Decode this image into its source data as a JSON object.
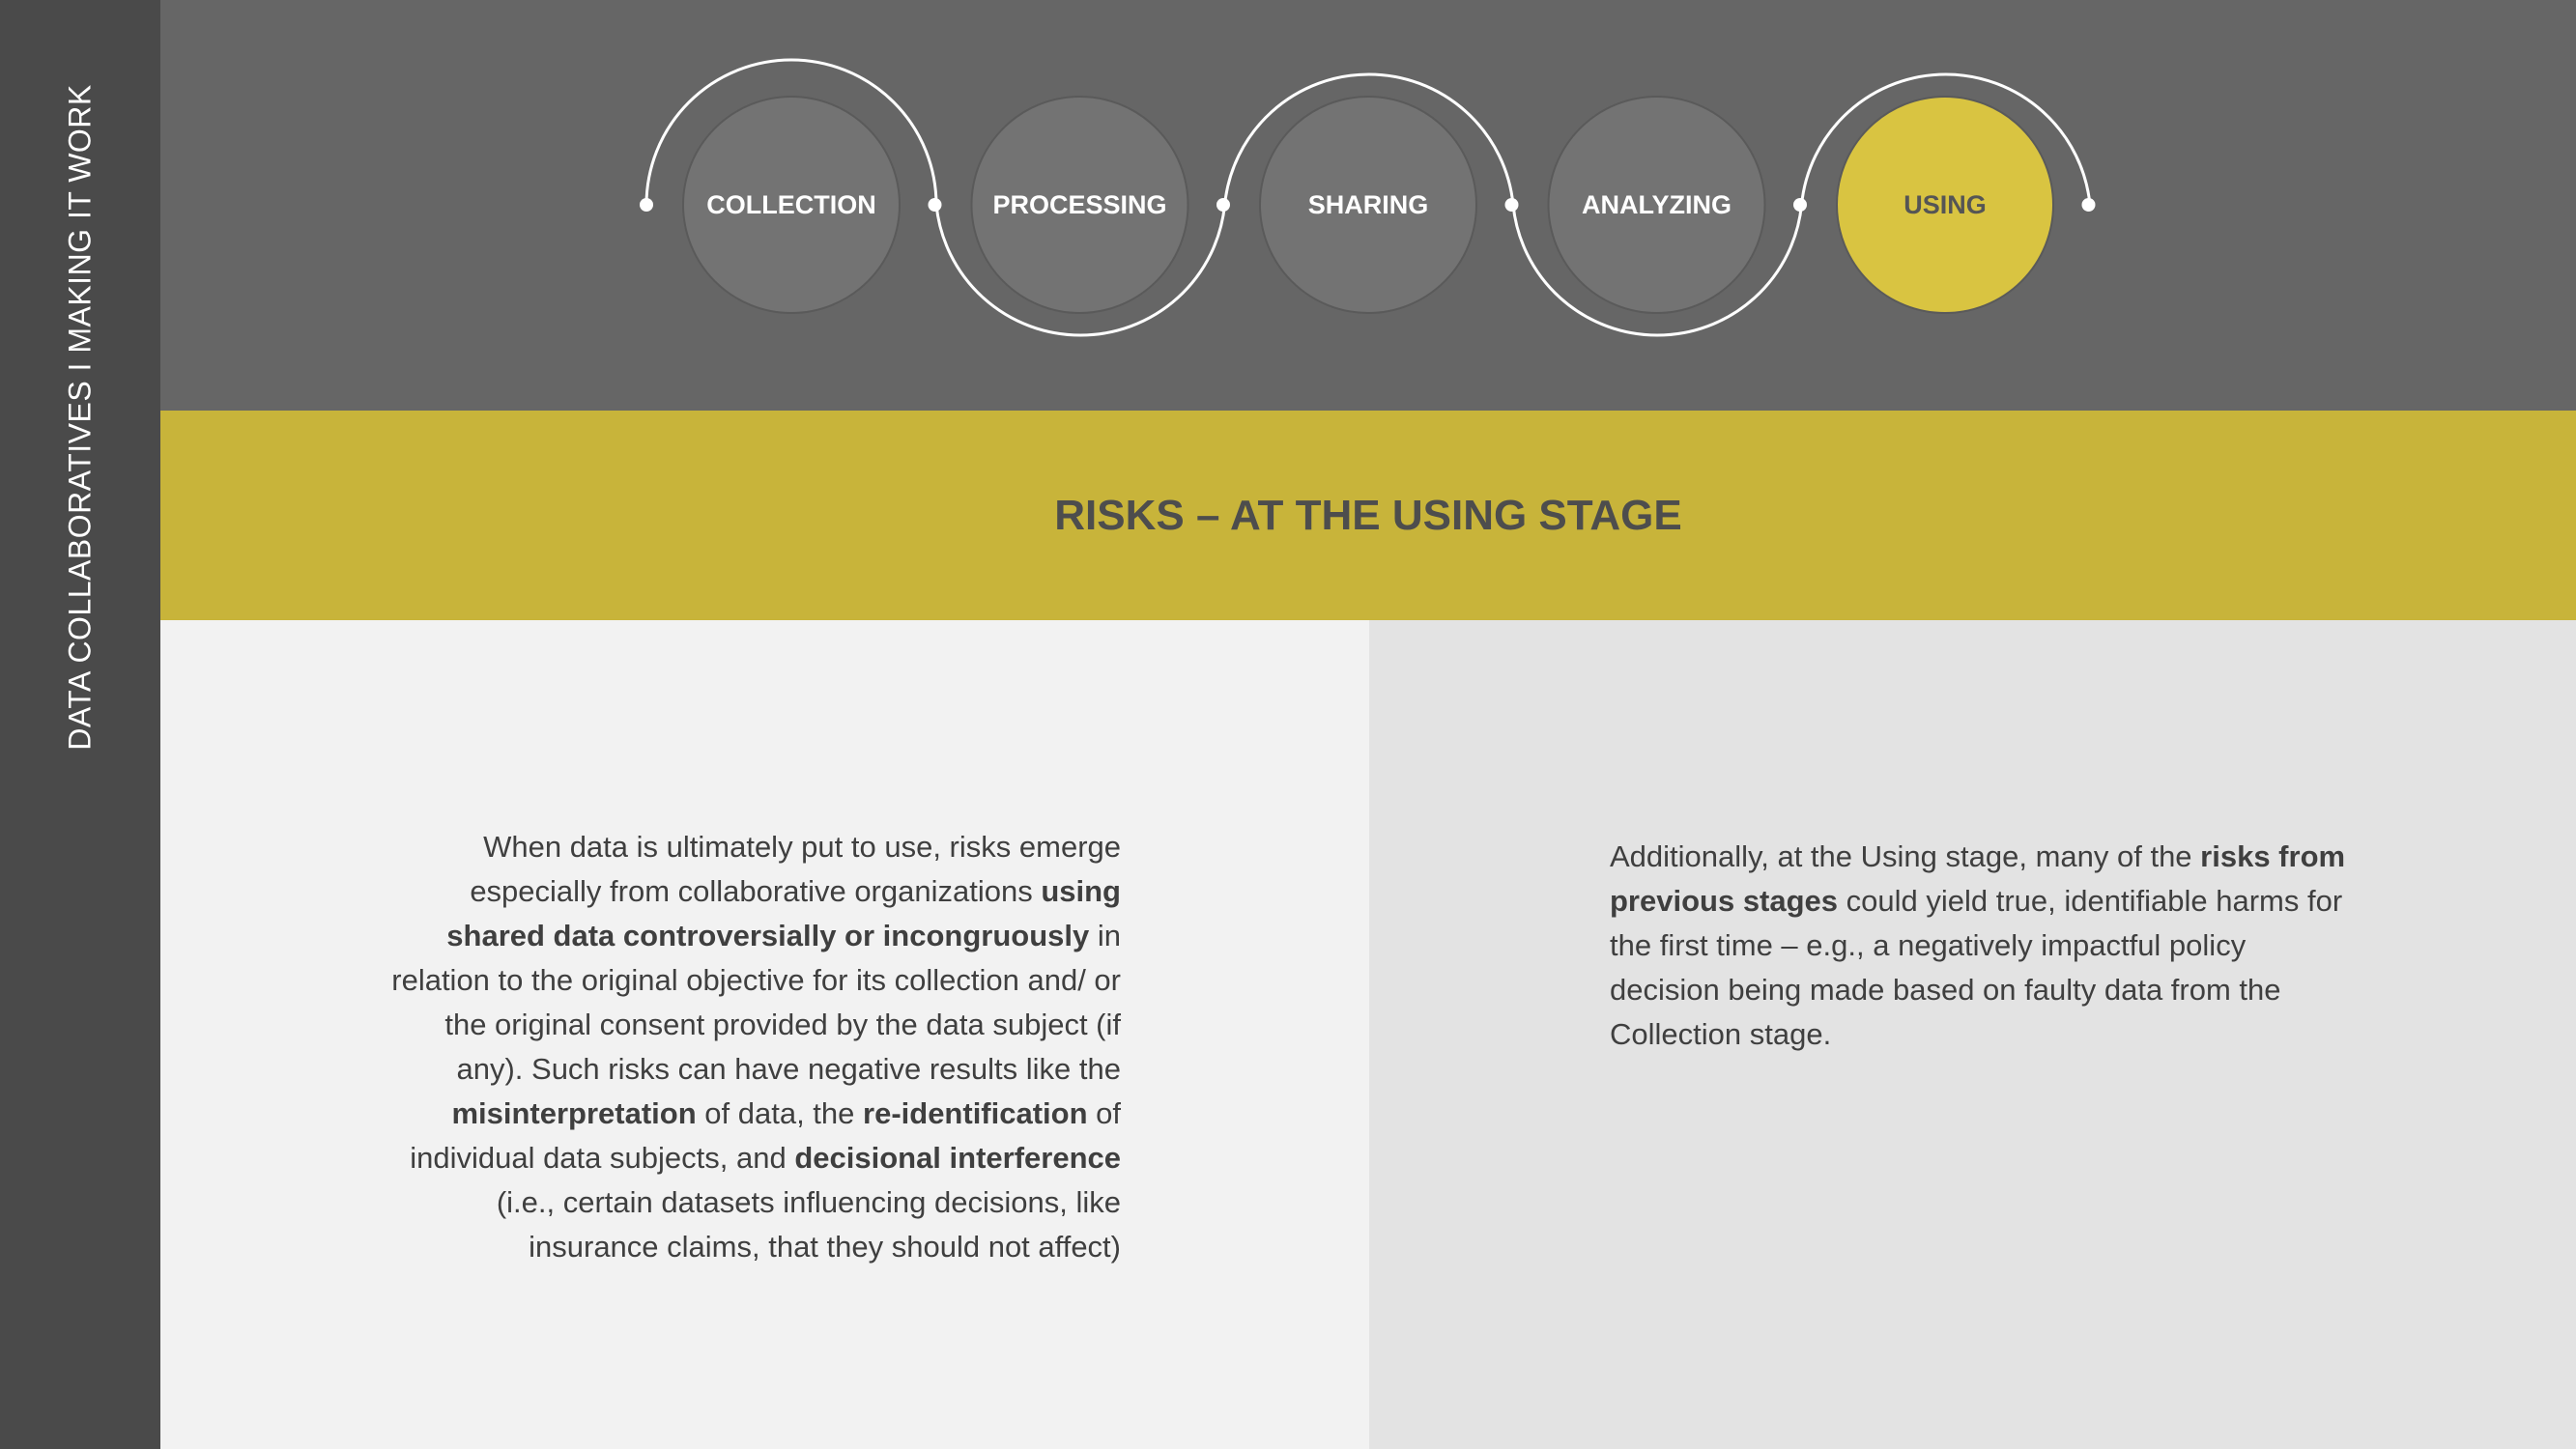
{
  "sidebar": {
    "title": "DATA COLLABORATIVES I MAKING IT WORK"
  },
  "stages": [
    {
      "label": "COLLECTION",
      "active": false
    },
    {
      "label": "PROCESSING",
      "active": false
    },
    {
      "label": "SHARING",
      "active": false
    },
    {
      "label": "ANALYZING",
      "active": false
    },
    {
      "label": "USING",
      "active": true
    }
  ],
  "colors": {
    "accent": "#c8b43a",
    "active_stage": "#d9c441",
    "stage_fill": "#737373",
    "band": "#666666",
    "sidebar": "#4a4a4a"
  },
  "title": "RISKS – AT THE USING STAGE",
  "left_text": [
    {
      "text": "When data is ultimately put to use, risks emerge especially from collaborative organizations ",
      "bold": false
    },
    {
      "text": "using shared data controversially or incongruously",
      "bold": true
    },
    {
      "text": " in relation to the original objective for its collection and/ or the original consent provided by the data subject (if any). Such risks can have negative results like the ",
      "bold": false
    },
    {
      "text": "misinterpretation",
      "bold": true
    },
    {
      "text": " of data, the ",
      "bold": false
    },
    {
      "text": "re-identification",
      "bold": true
    },
    {
      "text": " of individual data subjects, and ",
      "bold": false
    },
    {
      "text": "decisional interference",
      "bold": true
    },
    {
      "text": " (i.e., certain datasets influencing decisions, like insurance claims, that they should not affect)",
      "bold": false
    }
  ],
  "right_text": [
    {
      "text": "Additionally, at the Using stage, many of the ",
      "bold": false
    },
    {
      "text": "risks from previous stages",
      "bold": true
    },
    {
      "text": " could yield true, identifiable harms for the first time – e.g., a negatively impactful policy decision being made based on faulty data from the Collection stage.",
      "bold": false
    }
  ]
}
